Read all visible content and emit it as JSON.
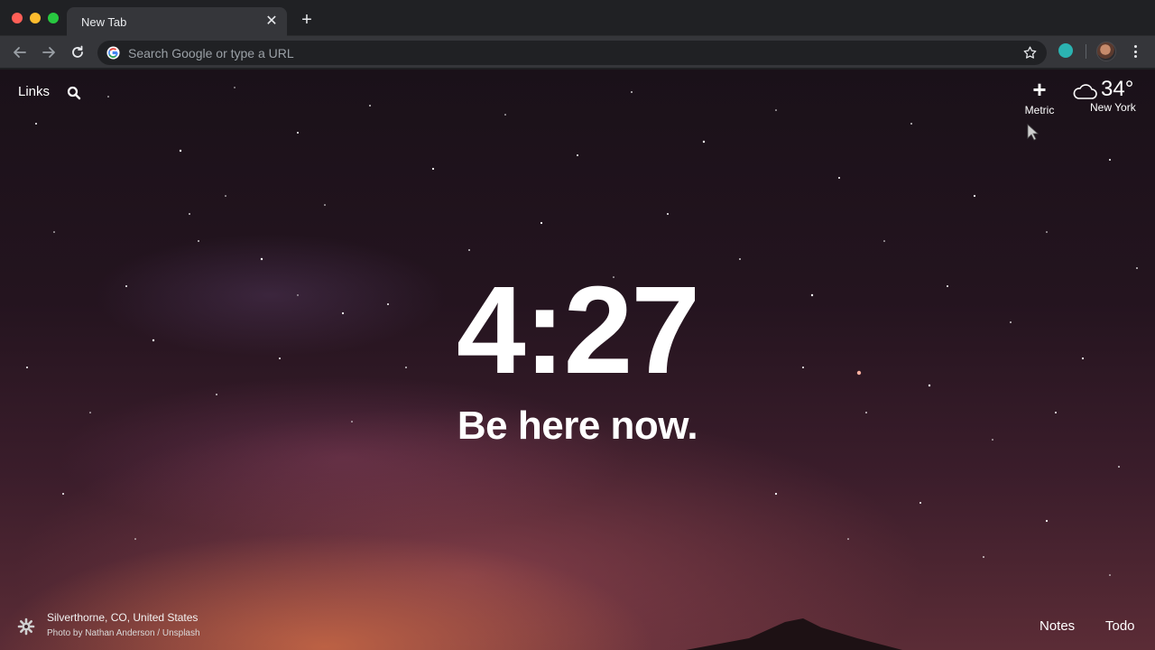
{
  "browser": {
    "tab_title": "New Tab",
    "omnibox_placeholder": "Search Google or type a URL",
    "icons": {
      "back": "arrow-left-icon",
      "forward": "arrow-right-icon",
      "reload": "reload-icon",
      "google": "google-icon",
      "bookmark": "star-icon",
      "extension": "extension-icon",
      "profile": "profile-avatar",
      "menu": "kebab-menu-icon",
      "tab_close": "close-icon",
      "new_tab": "plus-icon"
    }
  },
  "dashboard": {
    "links_label": "Links",
    "metric_label": "Metric",
    "temperature": "34°",
    "weather_location": "New York",
    "time": "4:27",
    "mantra": "Be here now.",
    "photo_location": "Silverthorne, CO, United States",
    "photo_credit": "Photo by Nathan Anderson / Unsplash",
    "notes_label": "Notes",
    "todo_label": "Todo"
  },
  "colors": {
    "chrome_bg": "#202124",
    "toolbar_bg": "#35363a",
    "text_white": "#ffffff",
    "extension_accent": "#2bb3b1"
  }
}
